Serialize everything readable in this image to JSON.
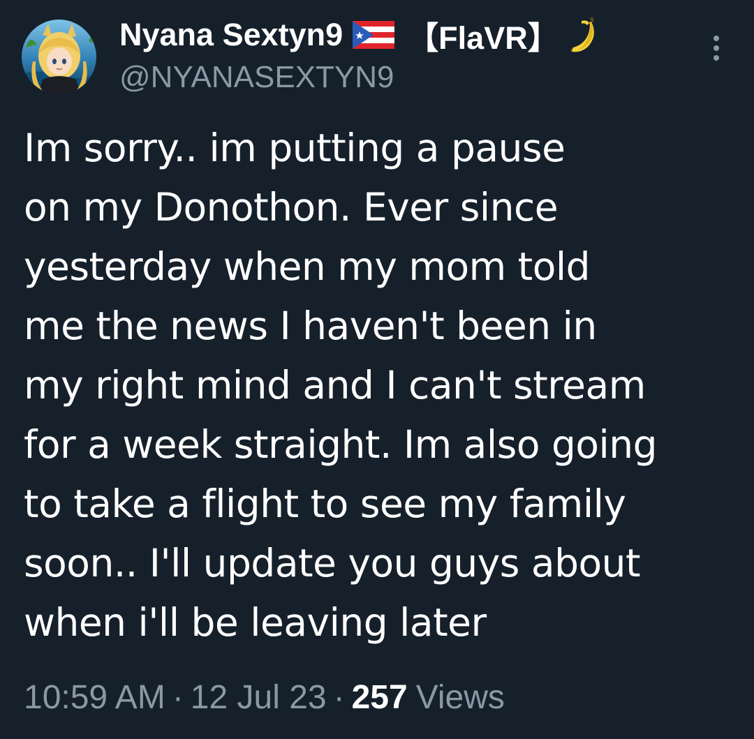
{
  "author": {
    "display_name": "Nyana Sextyn9",
    "flag_icon": "puerto-rico-flag-icon",
    "tag": "【FlaVR】",
    "emoji_icon": "banana-icon",
    "handle": "@NYANASEXTYN9"
  },
  "tweet": {
    "text": "Im sorry.. im putting a pause\non my Donothon. Ever since\nyesterday when my mom told\nme the news I haven't been in\nmy right mind and I can't stream\nfor a week straight. Im also going\nto take a flight to see my family\nsoon.. I'll update you guys about\nwhen i'll be leaving later",
    "time": "10:59 AM",
    "date": "12 Jul 23",
    "separator": "·",
    "views_count": "257",
    "views_label": "Views"
  },
  "menu": {
    "icon": "more-options-icon"
  },
  "colors": {
    "background": "#16202b",
    "text_primary": "#ffffff",
    "text_secondary": "#8b98a5"
  }
}
